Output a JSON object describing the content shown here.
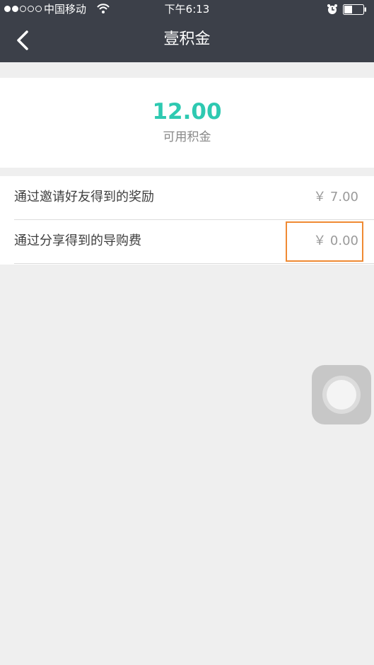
{
  "status_bar": {
    "carrier": "中国移动",
    "time": "下午6:13",
    "signal_dots_filled": 2,
    "signal_dots_total": 5
  },
  "navbar": {
    "title": "壹积金"
  },
  "balance": {
    "value": "12.00",
    "label": "可用积金"
  },
  "items": [
    {
      "label": "通过邀请好友得到的奖励",
      "amount": "￥ 7.00"
    },
    {
      "label": "通过分享得到的导购费",
      "amount": "￥ 0.00"
    }
  ],
  "colors": {
    "header_bg": "#3c4049",
    "accent": "#2ec9b1",
    "highlight": "#ef8a33"
  },
  "icons": {
    "back": "chevron-left-icon",
    "wifi": "wifi-icon",
    "alarm": "alarm-icon",
    "battery": "battery-icon",
    "assistive": "assistive-touch-icon"
  }
}
